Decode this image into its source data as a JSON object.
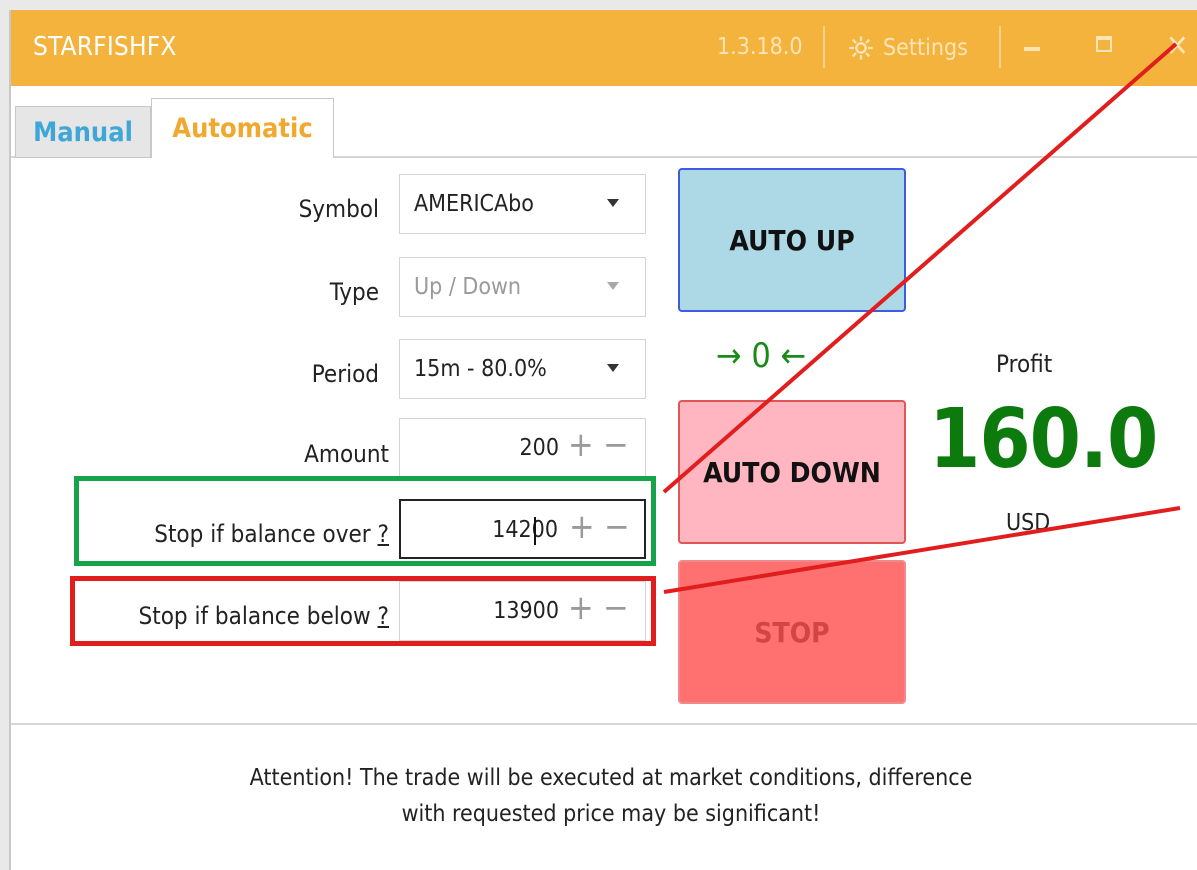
{
  "window": {
    "title": "STARFISHFX",
    "version": "1.3.18.0",
    "settings_label": "Settings",
    "close_glyph": "✕"
  },
  "tabs": [
    {
      "label": "Manual",
      "active": false
    },
    {
      "label": "Automatic",
      "active": true
    }
  ],
  "form": {
    "symbol": {
      "label": "Symbol",
      "value": "AMERICAbo"
    },
    "type": {
      "label": "Type",
      "value": "Up / Down",
      "disabled": true
    },
    "period": {
      "label": "Period",
      "value": "15m - 80.0%"
    },
    "amount": {
      "label": "Amount",
      "value": "200"
    },
    "stop_over": {
      "label": "Stop if balance over",
      "help": "?",
      "value": "14200"
    },
    "stop_below": {
      "label": "Stop if balance below",
      "help": "?",
      "value": "13900"
    },
    "plus_glyph": "+",
    "minus_glyph": "−"
  },
  "buttons": {
    "auto_up": "AUTO UP",
    "auto_down": "AUTO DOWN",
    "stop": "STOP"
  },
  "counter": "→ 0 ←",
  "profit": {
    "label": "Profit",
    "value": "160.0",
    "currency": "USD"
  },
  "notice": {
    "line1": "Attention! The trade will be executed at market conditions, difference",
    "line2": "with requested price may be significant!"
  },
  "colors": {
    "titlebar": "#f3b33d",
    "manual_tab": "#3fa6d8",
    "automatic_tab": "#f0a92e",
    "profit": "#0c7a0c",
    "highlight_green": "#16a34a",
    "highlight_red": "#e11d1d"
  },
  "icons": [
    "gear-icon",
    "minimize-icon",
    "maximize-icon",
    "close-icon",
    "dropdown-arrow-icon",
    "plus-icon",
    "minus-icon"
  ]
}
